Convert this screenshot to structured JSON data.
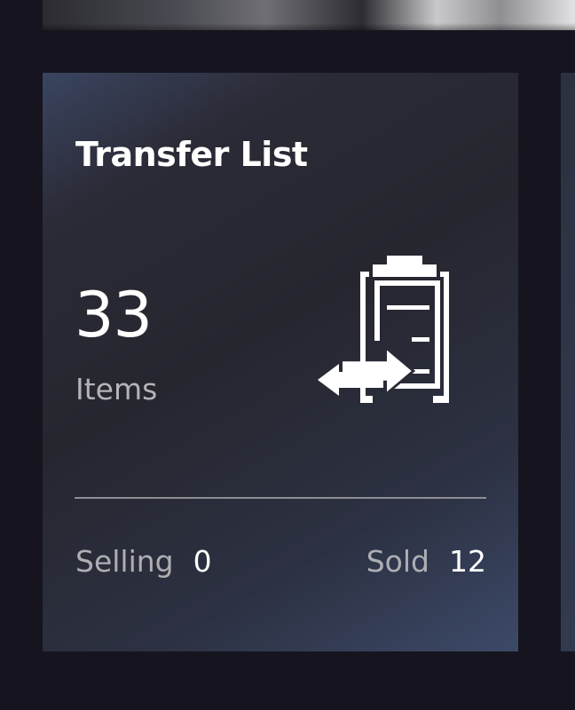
{
  "card": {
    "title": "Transfer List",
    "count": "33",
    "count_label": "Items",
    "icon": "clipboard-transfer-icon",
    "stats": {
      "selling_label": "Selling",
      "selling_value": "0",
      "sold_label": "Sold",
      "sold_value": "12"
    }
  },
  "colors": {
    "background": "#16151f",
    "card_dark": "#26262f",
    "card_accent": "#3c4968",
    "text_primary": "#ffffff",
    "text_secondary": "#b4b4b8",
    "divider": "#8d8e94"
  }
}
